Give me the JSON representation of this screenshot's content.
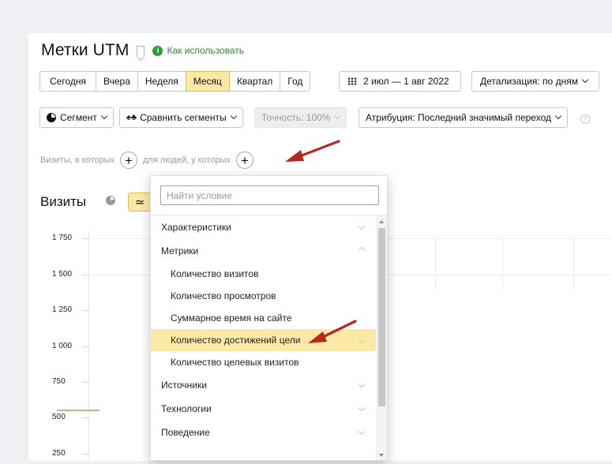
{
  "header": {
    "title": "Метки UTM",
    "help_link": "Как использовать",
    "info_glyph": "i"
  },
  "periods": [
    {
      "label": "Сегодня",
      "active": false
    },
    {
      "label": "Вчера",
      "active": false
    },
    {
      "label": "Неделя",
      "active": false
    },
    {
      "label": "Месяц",
      "active": true
    },
    {
      "label": "Квартал",
      "active": false
    },
    {
      "label": "Год",
      "active": false
    }
  ],
  "date_range": "2 июл — 1 авг 2022",
  "detail": "Детализация: по дням",
  "toolbar": {
    "segment": "Сегмент",
    "compare": "Сравнить сегменты",
    "accuracy": "Точность: 100%",
    "attribution": "Атрибуция: Последний значимый переход",
    "help_glyph": "?"
  },
  "filter": {
    "visits_label": "Визиты, в которых",
    "people_label": "для людей, у которых",
    "plus": "+"
  },
  "chart": {
    "title": "Визиты",
    "y_ticks": [
      "1 750",
      "1 500",
      "1 250",
      "1 000",
      "750",
      "500",
      "250"
    ]
  },
  "dropdown": {
    "search_placeholder": "Найти условие",
    "items": [
      {
        "label": "Характеристики",
        "level": 0,
        "expanded": false,
        "highlight": false
      },
      {
        "label": "Метрики",
        "level": 0,
        "expanded": true,
        "highlight": false
      },
      {
        "label": "Количество визитов",
        "level": 1,
        "expanded": false,
        "highlight": false
      },
      {
        "label": "Количество просмотров",
        "level": 1,
        "expanded": false,
        "highlight": false
      },
      {
        "label": "Суммарное время на сайте",
        "level": 1,
        "expanded": false,
        "highlight": false
      },
      {
        "label": "Количество достижений цели",
        "level": 1,
        "expanded": false,
        "highlight": true
      },
      {
        "label": "Количество целевых визитов",
        "level": 1,
        "expanded": false,
        "highlight": false
      },
      {
        "label": "Источники",
        "level": 0,
        "expanded": false,
        "highlight": false
      },
      {
        "label": "Технологии",
        "level": 0,
        "expanded": false,
        "highlight": false
      },
      {
        "label": "Поведение",
        "level": 0,
        "expanded": false,
        "highlight": false
      }
    ]
  },
  "colors": {
    "accent_yellow": "#fde9a6",
    "link_green": "#2d8a31",
    "arrow_red": "#b5281c"
  }
}
